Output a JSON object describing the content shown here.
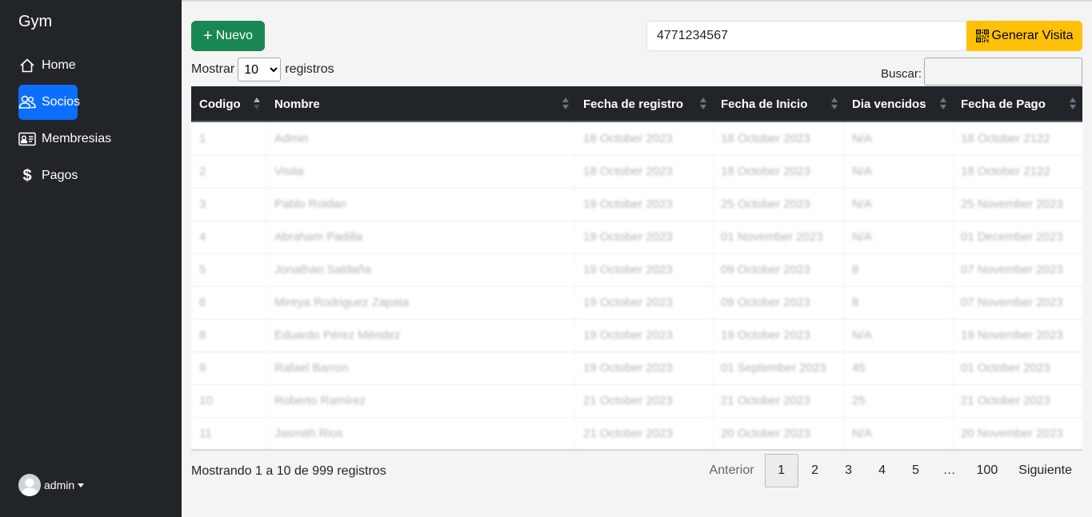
{
  "sidebar": {
    "brand": "Gym",
    "items": [
      {
        "label": "Home",
        "icon": "home-icon"
      },
      {
        "label": "Socios",
        "icon": "users-icon"
      },
      {
        "label": "Membresias",
        "icon": "id-card-icon"
      },
      {
        "label": "Pagos",
        "icon": "dollar-icon"
      }
    ],
    "active": "Socios",
    "user": "admin"
  },
  "toolbar": {
    "new_label": "Nuevo",
    "phone_value": "4771234567",
    "visit_label": "Generar Visita"
  },
  "table_controls": {
    "show_prefix": "Mostrar",
    "show_value": "10",
    "show_suffix": "registros",
    "search_label": "Buscar:"
  },
  "table": {
    "columns": [
      "Codigo",
      "Nombre",
      "Fecha de registro",
      "Fecha de Inicio",
      "Dia vencidos",
      "Fecha de Pago"
    ],
    "rows": [
      [
        "1",
        "Admin",
        "18 October 2023",
        "18 October 2023",
        "N/A",
        "18 October 2122"
      ],
      [
        "2",
        "Visita",
        "18 October 2023",
        "18 October 2023",
        "N/A",
        "18 October 2122"
      ],
      [
        "3",
        "Pablo Roldan",
        "19 October 2023",
        "25 October 2023",
        "N/A",
        "25 November 2023"
      ],
      [
        "4",
        "Abraham Padilla",
        "19 October 2023",
        "01 November 2023",
        "N/A",
        "01 December 2023"
      ],
      [
        "5",
        "Jonathan Saldaña",
        "19 October 2023",
        "09 October 2023",
        "8",
        "07 November 2023"
      ],
      [
        "6",
        "Mireya Rodriguez Zapata",
        "19 October 2023",
        "09 October 2023",
        "8",
        "07 November 2023"
      ],
      [
        "8",
        "Eduardo Pérez Méndez",
        "19 October 2023",
        "19 October 2023",
        "N/A",
        "19 November 2023"
      ],
      [
        "9",
        "Rafael Barron",
        "19 October 2023",
        "01 September 2023",
        "45",
        "01 October 2023"
      ],
      [
        "10",
        "Roberto Ramírez",
        "21 October 2023",
        "21 October 2023",
        "25",
        "21 October 2023"
      ],
      [
        "11",
        "Jasmith Rios",
        "21 October 2023",
        "20 October 2023",
        "N/A",
        "20 November 2023"
      ]
    ]
  },
  "footer": {
    "info": "Mostrando 1 a 10 de 999 registros",
    "prev": "Anterior",
    "pages": [
      "1",
      "2",
      "3",
      "4",
      "5",
      "…",
      "100"
    ],
    "current_page": "1",
    "next": "Siguiente"
  },
  "colors": {
    "sidebar_bg": "#212529",
    "active_nav": "#0d6efd",
    "new_button": "#198754",
    "visit_button": "#ffc107"
  }
}
